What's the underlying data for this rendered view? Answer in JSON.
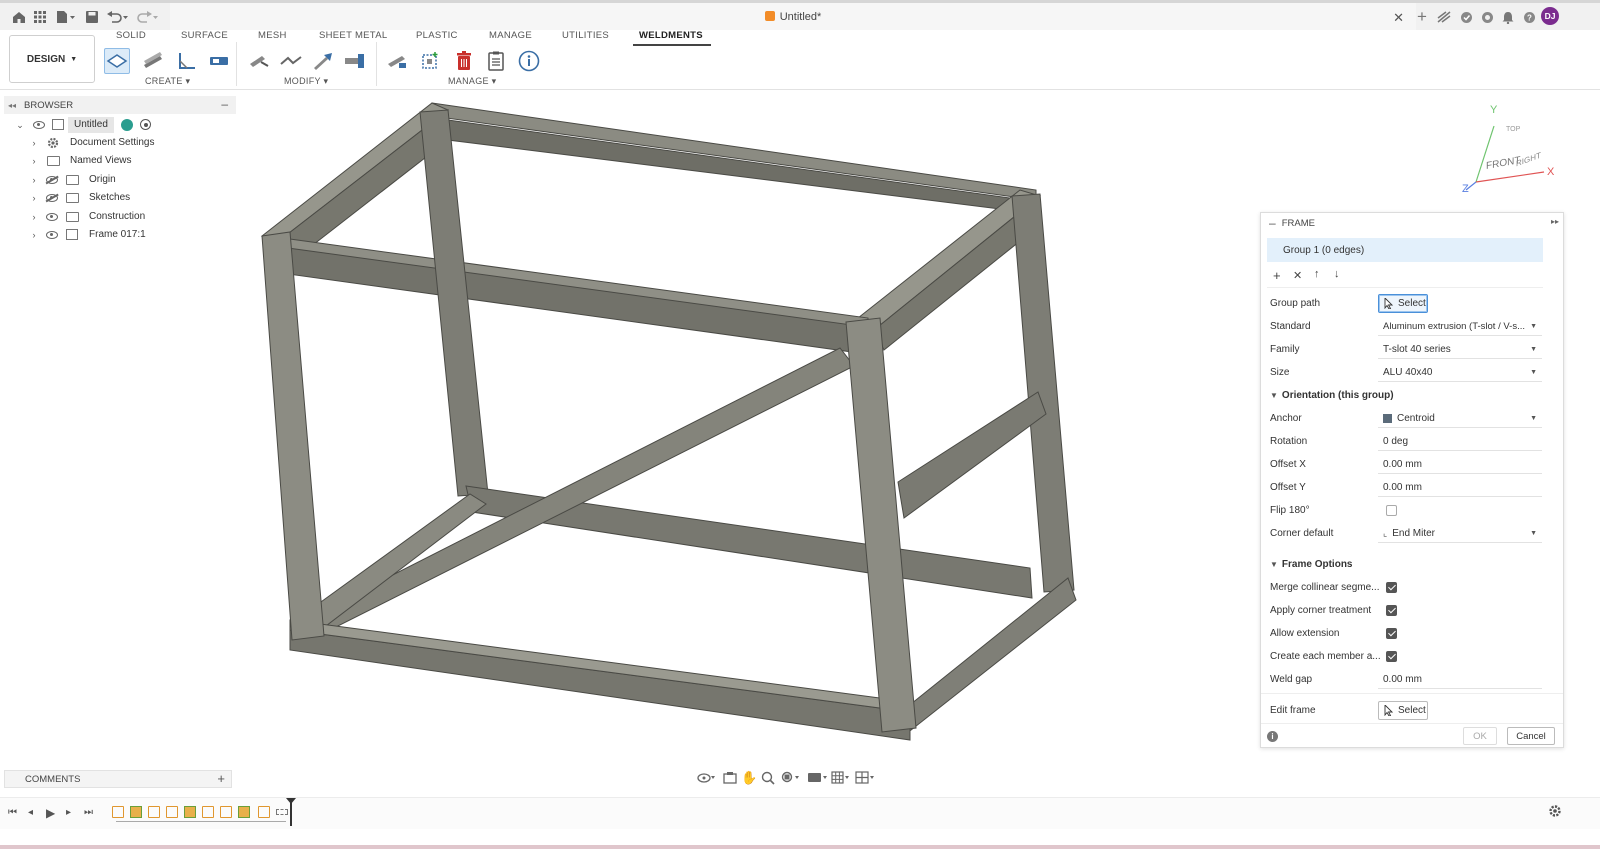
{
  "window": {
    "title": "Untitled*"
  },
  "user": {
    "initials": "DJ",
    "avatar_color": "#7b2c8f"
  },
  "workspace": {
    "label": "DESIGN"
  },
  "tabs": [
    {
      "label": "SOLID",
      "active": false
    },
    {
      "label": "SURFACE",
      "active": false
    },
    {
      "label": "MESH",
      "active": false
    },
    {
      "label": "SHEET METAL",
      "active": false
    },
    {
      "label": "PLASTIC",
      "active": false
    },
    {
      "label": "MANAGE",
      "active": false
    },
    {
      "label": "UTILITIES",
      "active": false
    },
    {
      "label": "WELDMENTS",
      "active": true
    }
  ],
  "tool_groups": {
    "create": "CREATE",
    "modify": "MODIFY",
    "manage": "MANAGE"
  },
  "browser": {
    "title": "BROWSER",
    "root": "Untitled",
    "items": [
      {
        "label": "Document Settings",
        "icon": "gear-icon"
      },
      {
        "label": "Named Views",
        "icon": "folder-icon"
      },
      {
        "label": "Origin",
        "icon": "folder-icon",
        "hidden": true
      },
      {
        "label": "Sketches",
        "icon": "folder-icon",
        "hidden": true
      },
      {
        "label": "Construction",
        "icon": "folder-icon"
      },
      {
        "label": "Frame 017:1",
        "icon": "component-icon"
      }
    ]
  },
  "viewcube": {
    "front": "FRONT",
    "right": "RIGHT",
    "top": "TOP",
    "axis_x": "X",
    "axis_y": "Y",
    "axis_z": "Z"
  },
  "frame_panel": {
    "title": "FRAME",
    "group": "Group 1  (0 edges)",
    "group_path_label": "Group path",
    "select_label": "Select",
    "standard_label": "Standard",
    "standard_value": "Aluminum extrusion (T-slot / V-s...",
    "family_label": "Family",
    "family_value": "T-slot 40 series",
    "size_label": "Size",
    "size_value": "ALU 40x40",
    "orientation_title": "Orientation (this group)",
    "anchor_label": "Anchor",
    "anchor_value": "Centroid",
    "rotation_label": "Rotation",
    "rotation_value": "0 deg",
    "offset_x_label": "Offset X",
    "offset_x_value": "0.00 mm",
    "offset_y_label": "Offset Y",
    "offset_y_value": "0.00 mm",
    "flip_label": "Flip 180°",
    "flip_checked": false,
    "corner_label": "Corner default",
    "corner_value": "End Miter",
    "options_title": "Frame Options",
    "merge_label": "Merge collinear segme...",
    "merge_checked": true,
    "corner_treat_label": "Apply corner treatment",
    "corner_treat_checked": true,
    "allow_ext_label": "Allow extension",
    "allow_ext_checked": true,
    "create_each_label": "Create each member a...",
    "create_each_checked": true,
    "weld_gap_label": "Weld gap",
    "weld_gap_value": "0.00 mm",
    "edit_frame_label": "Edit frame",
    "ok_label": "OK",
    "cancel_label": "Cancel"
  },
  "comments": {
    "label": "COMMENTS"
  },
  "colors": {
    "accent": "#2b7bd1",
    "frame_metal": "#8a8a80",
    "active_field": "#dcebf8"
  }
}
